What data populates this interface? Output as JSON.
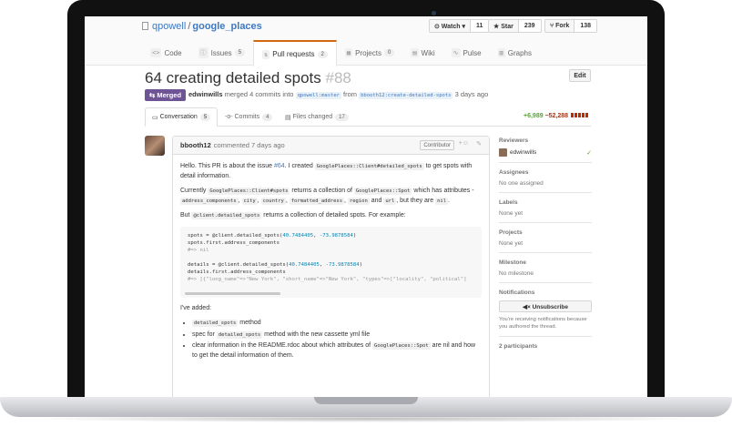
{
  "repo": {
    "owner": "qpowell",
    "sep": "/",
    "name": "google_places"
  },
  "actions": [
    {
      "label": "⊙ Watch ▾",
      "count": "11"
    },
    {
      "label": "★ Star",
      "count": "239"
    },
    {
      "label": "⑂ Fork",
      "count": "138"
    }
  ],
  "tabs": [
    {
      "icon": "<>",
      "label": "Code",
      "count": ""
    },
    {
      "icon": "ⓘ",
      "label": "Issues",
      "count": "5"
    },
    {
      "icon": "⇅",
      "label": "Pull requests",
      "count": "2"
    },
    {
      "icon": "▦",
      "label": "Projects",
      "count": "0"
    },
    {
      "icon": "▤",
      "label": "Wiki",
      "count": ""
    },
    {
      "icon": "∿",
      "label": "Pulse",
      "count": ""
    },
    {
      "icon": "▥",
      "label": "Graphs",
      "count": ""
    }
  ],
  "pr": {
    "title": "64 creating detailed spots",
    "number": "#88",
    "edit": "Edit",
    "status": "⇆ Merged",
    "author": "edwinwills",
    "merged_text": "merged 4 commits into",
    "base": "qpowell:master",
    "from": "from",
    "head": "bbooth12:create-detailed-spots",
    "when": "3 days ago"
  },
  "prtabs": [
    {
      "label": "Conversation",
      "count": "5"
    },
    {
      "label": "Commits",
      "count": "4"
    },
    {
      "label": "Files changed",
      "count": "17"
    }
  ],
  "diffstat": {
    "add": "+6,989",
    "del": "−52,288"
  },
  "comment": {
    "author": "bbooth12",
    "meta": "commented 7 days ago",
    "badge": "Contributor",
    "p1a": "Hello. This PR is about the issue ",
    "p1link": "#64",
    "p1b": ". I created ",
    "p1code": "GooglePlaces::Client#detailed_spots",
    "p1c": " to get spots with detail information.",
    "p2a": "Currently ",
    "p2code1": "GooglePlaces::Client#spots",
    "p2b": " returns a collection of ",
    "p2code2": "GooglePlaces::Spot",
    "p2c": " which has attributes - ",
    "p2code3": "address_components",
    "p2d": ", ",
    "p2code4": "city",
    "p2e": ", ",
    "p2code5": "country",
    "p2f": ", ",
    "p2code6": "formatted_address",
    "p2g": ", ",
    "p2code7": "region",
    "p2h": " and ",
    "p2code8": "url",
    "p2i": ", but they are ",
    "p2code9": "nil",
    "p2j": ".",
    "p3a": "But ",
    "p3code": "@client.detailed_spots",
    "p3b": " returns a collection of detailed spots. For example:",
    "code1": "spots = @client.detailed_spots(",
    "code1n1": "40.7484405",
    "code1m": ", ",
    "code1n2": "-73.9878584",
    "code1e": ")",
    "code2": "spots.first.address_components",
    "code3": "#=> nil",
    "code4": "details = @client.detailed_spots(",
    "code4n1": "40.7484405",
    "code4m": ", ",
    "code4n2": "-73.9878584",
    "code4e": ")",
    "code5": "details.first.address_components",
    "code6": "#=> [{\"long_name\"=>\"New York\", \"short_name\"=>\"New York\", \"types\"=>[\"locality\", \"political\"]",
    "added": "I've added:",
    "li1code": "detailed_spots",
    "li1": " method",
    "li2a": "spec for ",
    "li2code": "detailed_spots",
    "li2b": " method with the new cassette yml file",
    "li3a": "clear information in the README.rdoc about which attributes of ",
    "li3code": "GooglePlaces::Spot",
    "li3b": " are nil and how to get the detail information of them."
  },
  "sidebar": {
    "reviewers_h": "Reviewers",
    "reviewer": "edwinwills",
    "assignees_h": "Assignees",
    "assignees_v": "No one assigned",
    "labels_h": "Labels",
    "labels_v": "None yet",
    "projects_h": "Projects",
    "projects_v": "None yet",
    "milestone_h": "Milestone",
    "milestone_v": "No milestone",
    "notif_h": "Notifications",
    "unsub": "◀× Unsubscribe",
    "notif_note": "You're receiving notifications because you authored the thread.",
    "participants_h": "2 participants"
  }
}
